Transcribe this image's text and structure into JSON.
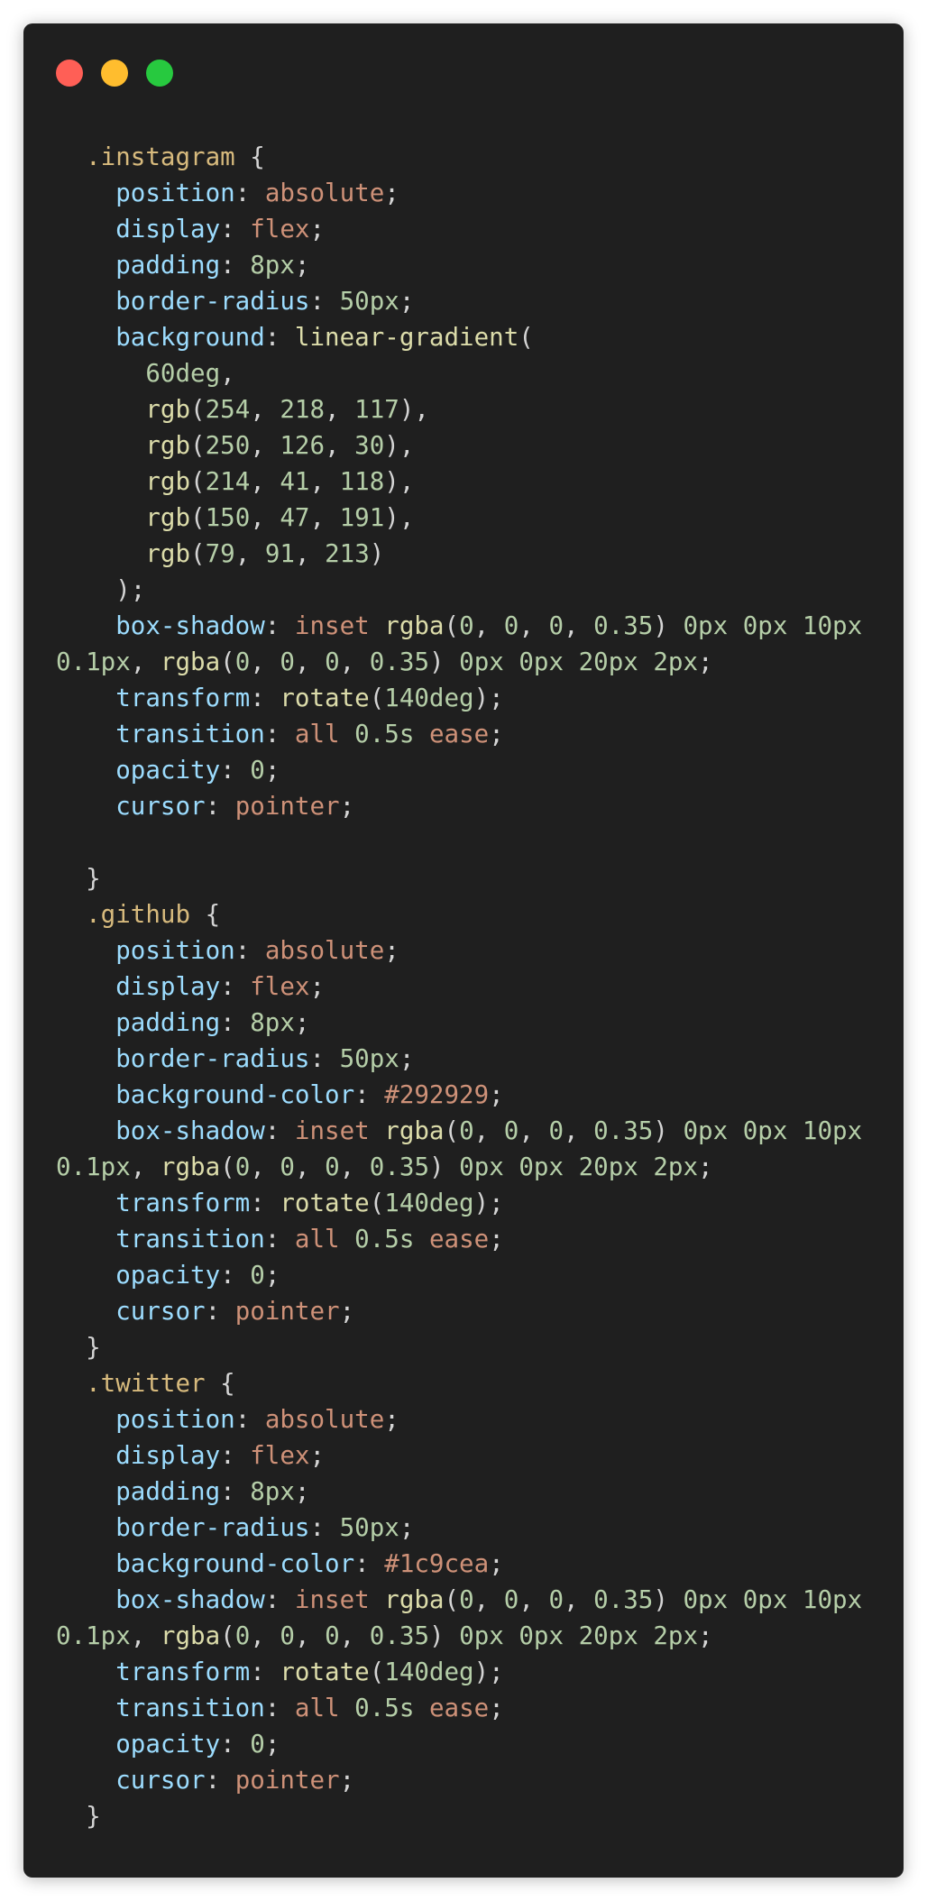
{
  "window": {
    "controls": [
      {
        "name": "close",
        "color": "#ff5f56"
      },
      {
        "name": "minimize",
        "color": "#ffbd2e"
      },
      {
        "name": "maximize",
        "color": "#27c93f"
      }
    ]
  },
  "code_lines": [
    [
      [
        "sel",
        "  .instagram "
      ],
      [
        "punc",
        "{"
      ]
    ],
    [
      [
        "prop",
        "    position"
      ],
      [
        "punc",
        ": "
      ],
      [
        "kw",
        "absolute"
      ],
      [
        "punc",
        ";"
      ]
    ],
    [
      [
        "prop",
        "    display"
      ],
      [
        "punc",
        ": "
      ],
      [
        "kw",
        "flex"
      ],
      [
        "punc",
        ";"
      ]
    ],
    [
      [
        "prop",
        "    padding"
      ],
      [
        "punc",
        ": "
      ],
      [
        "num",
        "8px"
      ],
      [
        "punc",
        ";"
      ]
    ],
    [
      [
        "prop",
        "    border-radius"
      ],
      [
        "punc",
        ": "
      ],
      [
        "num",
        "50px"
      ],
      [
        "punc",
        ";"
      ]
    ],
    [
      [
        "prop",
        "    background"
      ],
      [
        "punc",
        ": "
      ],
      [
        "fn",
        "linear-gradient"
      ],
      [
        "punc",
        "("
      ]
    ],
    [
      [
        "num",
        "      60deg"
      ],
      [
        "punc",
        ","
      ]
    ],
    [
      [
        "fn",
        "      rgb"
      ],
      [
        "punc",
        "("
      ],
      [
        "num",
        "254"
      ],
      [
        "punc",
        ", "
      ],
      [
        "num",
        "218"
      ],
      [
        "punc",
        ", "
      ],
      [
        "num",
        "117"
      ],
      [
        "punc",
        "),"
      ]
    ],
    [
      [
        "fn",
        "      rgb"
      ],
      [
        "punc",
        "("
      ],
      [
        "num",
        "250"
      ],
      [
        "punc",
        ", "
      ],
      [
        "num",
        "126"
      ],
      [
        "punc",
        ", "
      ],
      [
        "num",
        "30"
      ],
      [
        "punc",
        "),"
      ]
    ],
    [
      [
        "fn",
        "      rgb"
      ],
      [
        "punc",
        "("
      ],
      [
        "num",
        "214"
      ],
      [
        "punc",
        ", "
      ],
      [
        "num",
        "41"
      ],
      [
        "punc",
        ", "
      ],
      [
        "num",
        "118"
      ],
      [
        "punc",
        "),"
      ]
    ],
    [
      [
        "fn",
        "      rgb"
      ],
      [
        "punc",
        "("
      ],
      [
        "num",
        "150"
      ],
      [
        "punc",
        ", "
      ],
      [
        "num",
        "47"
      ],
      [
        "punc",
        ", "
      ],
      [
        "num",
        "191"
      ],
      [
        "punc",
        "),"
      ]
    ],
    [
      [
        "fn",
        "      rgb"
      ],
      [
        "punc",
        "("
      ],
      [
        "num",
        "79"
      ],
      [
        "punc",
        ", "
      ],
      [
        "num",
        "91"
      ],
      [
        "punc",
        ", "
      ],
      [
        "num",
        "213"
      ],
      [
        "punc",
        ")"
      ]
    ],
    [
      [
        "punc",
        "    );"
      ]
    ],
    [
      [
        "prop",
        "    box-shadow"
      ],
      [
        "punc",
        ": "
      ],
      [
        "kw",
        "inset "
      ],
      [
        "fn",
        "rgba"
      ],
      [
        "punc",
        "("
      ],
      [
        "num",
        "0"
      ],
      [
        "punc",
        ", "
      ],
      [
        "num",
        "0"
      ],
      [
        "punc",
        ", "
      ],
      [
        "num",
        "0"
      ],
      [
        "punc",
        ", "
      ],
      [
        "num",
        "0.35"
      ],
      [
        "punc",
        ") "
      ],
      [
        "num",
        "0px 0px 10px"
      ]
    ],
    [
      [
        "num",
        "0.1px"
      ],
      [
        "punc",
        ", "
      ],
      [
        "fn",
        "rgba"
      ],
      [
        "punc",
        "("
      ],
      [
        "num",
        "0"
      ],
      [
        "punc",
        ", "
      ],
      [
        "num",
        "0"
      ],
      [
        "punc",
        ", "
      ],
      [
        "num",
        "0"
      ],
      [
        "punc",
        ", "
      ],
      [
        "num",
        "0.35"
      ],
      [
        "punc",
        ") "
      ],
      [
        "num",
        "0px 0px 20px 2px"
      ],
      [
        "punc",
        ";"
      ]
    ],
    [
      [
        "prop",
        "    transform"
      ],
      [
        "punc",
        ": "
      ],
      [
        "fn",
        "rotate"
      ],
      [
        "punc",
        "("
      ],
      [
        "num",
        "140deg"
      ],
      [
        "punc",
        ");"
      ]
    ],
    [
      [
        "prop",
        "    transition"
      ],
      [
        "punc",
        ": "
      ],
      [
        "kw",
        "all "
      ],
      [
        "num",
        "0.5s "
      ],
      [
        "kw",
        "ease"
      ],
      [
        "punc",
        ";"
      ]
    ],
    [
      [
        "prop",
        "    opacity"
      ],
      [
        "punc",
        ": "
      ],
      [
        "num",
        "0"
      ],
      [
        "punc",
        ";"
      ]
    ],
    [
      [
        "prop",
        "    cursor"
      ],
      [
        "punc",
        ": "
      ],
      [
        "kw",
        "pointer"
      ],
      [
        "punc",
        ";"
      ]
    ],
    [],
    [
      [
        "punc",
        "  }"
      ]
    ],
    [
      [
        "sel",
        "  .github "
      ],
      [
        "punc",
        "{"
      ]
    ],
    [
      [
        "prop",
        "    position"
      ],
      [
        "punc",
        ": "
      ],
      [
        "kw",
        "absolute"
      ],
      [
        "punc",
        ";"
      ]
    ],
    [
      [
        "prop",
        "    display"
      ],
      [
        "punc",
        ": "
      ],
      [
        "kw",
        "flex"
      ],
      [
        "punc",
        ";"
      ]
    ],
    [
      [
        "prop",
        "    padding"
      ],
      [
        "punc",
        ": "
      ],
      [
        "num",
        "8px"
      ],
      [
        "punc",
        ";"
      ]
    ],
    [
      [
        "prop",
        "    border-radius"
      ],
      [
        "punc",
        ": "
      ],
      [
        "num",
        "50px"
      ],
      [
        "punc",
        ";"
      ]
    ],
    [
      [
        "prop",
        "    background-color"
      ],
      [
        "punc",
        ": "
      ],
      [
        "kw",
        "#292929"
      ],
      [
        "punc",
        ";"
      ]
    ],
    [
      [
        "prop",
        "    box-shadow"
      ],
      [
        "punc",
        ": "
      ],
      [
        "kw",
        "inset "
      ],
      [
        "fn",
        "rgba"
      ],
      [
        "punc",
        "("
      ],
      [
        "num",
        "0"
      ],
      [
        "punc",
        ", "
      ],
      [
        "num",
        "0"
      ],
      [
        "punc",
        ", "
      ],
      [
        "num",
        "0"
      ],
      [
        "punc",
        ", "
      ],
      [
        "num",
        "0.35"
      ],
      [
        "punc",
        ") "
      ],
      [
        "num",
        "0px 0px 10px"
      ]
    ],
    [
      [
        "num",
        "0.1px"
      ],
      [
        "punc",
        ", "
      ],
      [
        "fn",
        "rgba"
      ],
      [
        "punc",
        "("
      ],
      [
        "num",
        "0"
      ],
      [
        "punc",
        ", "
      ],
      [
        "num",
        "0"
      ],
      [
        "punc",
        ", "
      ],
      [
        "num",
        "0"
      ],
      [
        "punc",
        ", "
      ],
      [
        "num",
        "0.35"
      ],
      [
        "punc",
        ") "
      ],
      [
        "num",
        "0px 0px 20px 2px"
      ],
      [
        "punc",
        ";"
      ]
    ],
    [
      [
        "prop",
        "    transform"
      ],
      [
        "punc",
        ": "
      ],
      [
        "fn",
        "rotate"
      ],
      [
        "punc",
        "("
      ],
      [
        "num",
        "140deg"
      ],
      [
        "punc",
        ");"
      ]
    ],
    [
      [
        "prop",
        "    transition"
      ],
      [
        "punc",
        ": "
      ],
      [
        "kw",
        "all "
      ],
      [
        "num",
        "0.5s "
      ],
      [
        "kw",
        "ease"
      ],
      [
        "punc",
        ";"
      ]
    ],
    [
      [
        "prop",
        "    opacity"
      ],
      [
        "punc",
        ": "
      ],
      [
        "num",
        "0"
      ],
      [
        "punc",
        ";"
      ]
    ],
    [
      [
        "prop",
        "    cursor"
      ],
      [
        "punc",
        ": "
      ],
      [
        "kw",
        "pointer"
      ],
      [
        "punc",
        ";"
      ]
    ],
    [
      [
        "punc",
        "  }"
      ]
    ],
    [
      [
        "sel",
        "  .twitter "
      ],
      [
        "punc",
        "{"
      ]
    ],
    [
      [
        "prop",
        "    position"
      ],
      [
        "punc",
        ": "
      ],
      [
        "kw",
        "absolute"
      ],
      [
        "punc",
        ";"
      ]
    ],
    [
      [
        "prop",
        "    display"
      ],
      [
        "punc",
        ": "
      ],
      [
        "kw",
        "flex"
      ],
      [
        "punc",
        ";"
      ]
    ],
    [
      [
        "prop",
        "    padding"
      ],
      [
        "punc",
        ": "
      ],
      [
        "num",
        "8px"
      ],
      [
        "punc",
        ";"
      ]
    ],
    [
      [
        "prop",
        "    border-radius"
      ],
      [
        "punc",
        ": "
      ],
      [
        "num",
        "50px"
      ],
      [
        "punc",
        ";"
      ]
    ],
    [
      [
        "prop",
        "    background-color"
      ],
      [
        "punc",
        ": "
      ],
      [
        "kw",
        "#1c9cea"
      ],
      [
        "punc",
        ";"
      ]
    ],
    [
      [
        "prop",
        "    box-shadow"
      ],
      [
        "punc",
        ": "
      ],
      [
        "kw",
        "inset "
      ],
      [
        "fn",
        "rgba"
      ],
      [
        "punc",
        "("
      ],
      [
        "num",
        "0"
      ],
      [
        "punc",
        ", "
      ],
      [
        "num",
        "0"
      ],
      [
        "punc",
        ", "
      ],
      [
        "num",
        "0"
      ],
      [
        "punc",
        ", "
      ],
      [
        "num",
        "0.35"
      ],
      [
        "punc",
        ") "
      ],
      [
        "num",
        "0px 0px 10px"
      ]
    ],
    [
      [
        "num",
        "0.1px"
      ],
      [
        "punc",
        ", "
      ],
      [
        "fn",
        "rgba"
      ],
      [
        "punc",
        "("
      ],
      [
        "num",
        "0"
      ],
      [
        "punc",
        ", "
      ],
      [
        "num",
        "0"
      ],
      [
        "punc",
        ", "
      ],
      [
        "num",
        "0"
      ],
      [
        "punc",
        ", "
      ],
      [
        "num",
        "0.35"
      ],
      [
        "punc",
        ") "
      ],
      [
        "num",
        "0px 0px 20px 2px"
      ],
      [
        "punc",
        ";"
      ]
    ],
    [
      [
        "prop",
        "    transform"
      ],
      [
        "punc",
        ": "
      ],
      [
        "fn",
        "rotate"
      ],
      [
        "punc",
        "("
      ],
      [
        "num",
        "140deg"
      ],
      [
        "punc",
        ");"
      ]
    ],
    [
      [
        "prop",
        "    transition"
      ],
      [
        "punc",
        ": "
      ],
      [
        "kw",
        "all "
      ],
      [
        "num",
        "0.5s "
      ],
      [
        "kw",
        "ease"
      ],
      [
        "punc",
        ";"
      ]
    ],
    [
      [
        "prop",
        "    opacity"
      ],
      [
        "punc",
        ": "
      ],
      [
        "num",
        "0"
      ],
      [
        "punc",
        ";"
      ]
    ],
    [
      [
        "prop",
        "    cursor"
      ],
      [
        "punc",
        ": "
      ],
      [
        "kw",
        "pointer"
      ],
      [
        "punc",
        ";"
      ]
    ],
    [
      [
        "punc",
        "  }"
      ]
    ]
  ]
}
